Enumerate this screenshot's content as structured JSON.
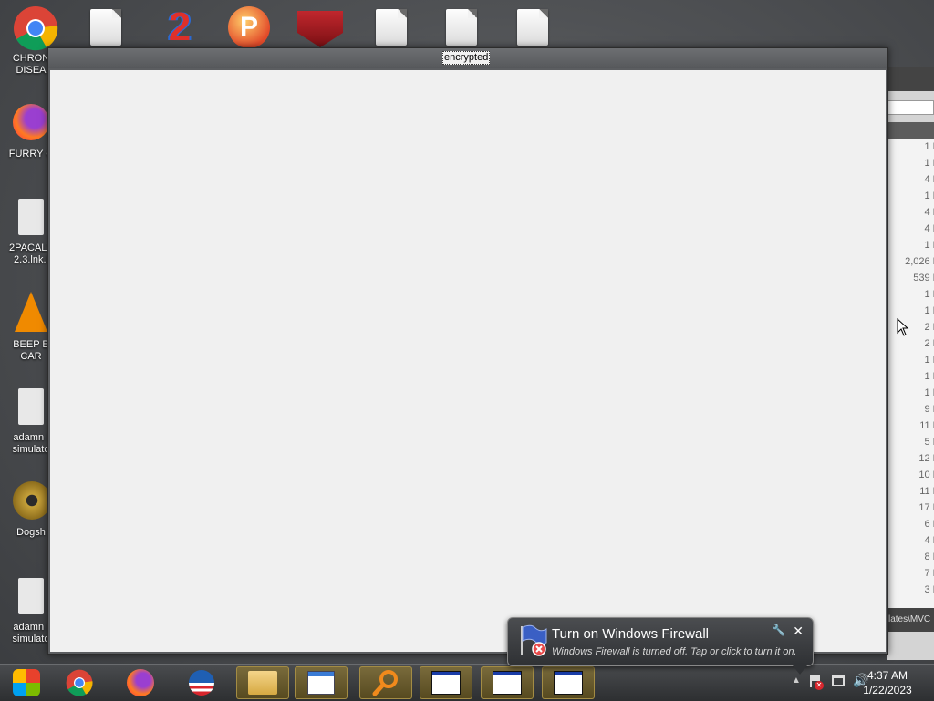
{
  "desktop": {
    "left_icons": [
      {
        "label": "CHRON\nDISEA",
        "icon": "chrome-icon"
      },
      {
        "label": "FURRY C",
        "icon": "firefox-icon"
      },
      {
        "label": "2PACALY\n2.3.lnk.l",
        "icon": "file-icon"
      },
      {
        "label": "BEEP B\nCAR",
        "icon": "vlc-icon"
      },
      {
        "label": "adamn l\nsimulato",
        "icon": "file-icon"
      },
      {
        "label": "Dogsh",
        "icon": "disc-icon"
      },
      {
        "label": "adamn l\nsimulato",
        "icon": "file-icon"
      }
    ],
    "top_icons": [
      "chrome-icon",
      "file-icon",
      "number-2-icon",
      "p-logo-icon",
      "shield-icon",
      "file-icon",
      "file-icon",
      "file-icon"
    ]
  },
  "main_window": {
    "title": "encrypted"
  },
  "background_window": {
    "sizes": [
      "1 K",
      "1 K",
      "4 K",
      "1 K",
      "4 K",
      "4 K",
      "1 K",
      "2,026 K",
      "539 K",
      "1 K",
      "1 K",
      "2 K",
      "2 K",
      "1 K",
      "1 K",
      "1 K",
      "9 K",
      "11 K",
      "5 K",
      "12 K",
      "10 K",
      "11 K",
      "17 K",
      "6 K",
      "4 K",
      "8 K",
      "7 K",
      "3 K"
    ],
    "footer": "lates\\MVC"
  },
  "taskbar": {
    "buttons": [
      "media-center-icon",
      "chrome-icon",
      "firefox-icon",
      "obama-logo-icon",
      "file-explorer-icon",
      "document-viewer-icon",
      "search-icon",
      "window-icon",
      "window-icon",
      "window-icon"
    ],
    "clock": {
      "time": "4:37 AM",
      "date": "1/22/2023"
    }
  },
  "balloon": {
    "title": "Turn on Windows Firewall",
    "text": "Windows Firewall is turned off. Tap or click to turn it on."
  }
}
